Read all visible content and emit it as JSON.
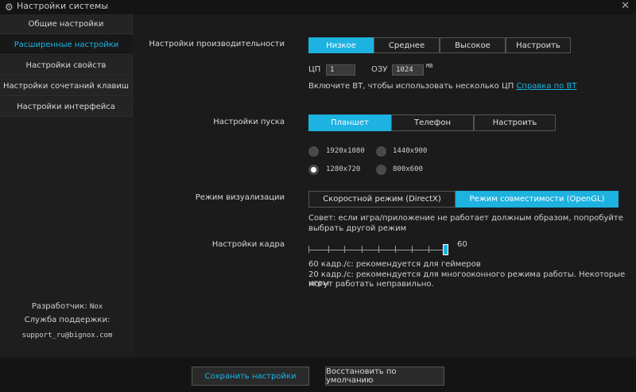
{
  "window": {
    "title": "Настройки системы",
    "close": "✕"
  },
  "sidebar": {
    "items": [
      {
        "label": "Общие настройки"
      },
      {
        "label": "Расширенные настройки"
      },
      {
        "label": "Настройки свойств"
      },
      {
        "label": "Настройки сочетаний клавиш"
      },
      {
        "label": "Настройки интерфейса"
      }
    ],
    "developer_label": "Разработчик:",
    "developer_value": "Nox",
    "support_label": "Служба поддержки:",
    "support_email": "support_ru@bignox.com"
  },
  "performance": {
    "label": "Настройки производительности",
    "options": [
      "Низкое",
      "Среднее",
      "Высокое",
      "Настроить"
    ],
    "selected": "Низкое",
    "cpu_label": "ЦП",
    "cpu_value": "1",
    "ram_label": "ОЗУ",
    "ram_value": "1024",
    "ram_unit": "MB",
    "vt_hint": "Включите ВТ, чтобы использовать несколько ЦП",
    "vt_link": "Справка по ВТ"
  },
  "startup": {
    "label": "Настройки пуска",
    "options": [
      "Планшет",
      "Телефон",
      "Настроить"
    ],
    "selected": "Планшет",
    "resolutions": [
      "1920x1080",
      "1440x900",
      "1280x720",
      "800x600"
    ],
    "selected_resolution": "1280x720"
  },
  "render": {
    "label": "Режим визуализации",
    "options": [
      "Скоростной режим (DirectX)",
      "Режим совместимости (OpenGL)"
    ],
    "selected": "Режим совместимости (OpenGL)",
    "tip_line1": "Совет: если игра/приложение не работает должным образом, попробуйте",
    "tip_line2": "выбрать другой режим"
  },
  "frame": {
    "label": "Настройки кадра",
    "value": "60",
    "level": 1.0,
    "note1": "60 кадр./с: рекомендуется для геймеров",
    "note2": "20 кадр./с: рекомендуется для многооконного режима работы. Некоторые игры",
    "note3": "могут работать неправильно."
  },
  "footer": {
    "save": "Сохранить настройки",
    "restore": "Восстановить по умолчанию"
  },
  "colors": {
    "accent": "#1db2e0",
    "background": "#1b1b1b"
  }
}
